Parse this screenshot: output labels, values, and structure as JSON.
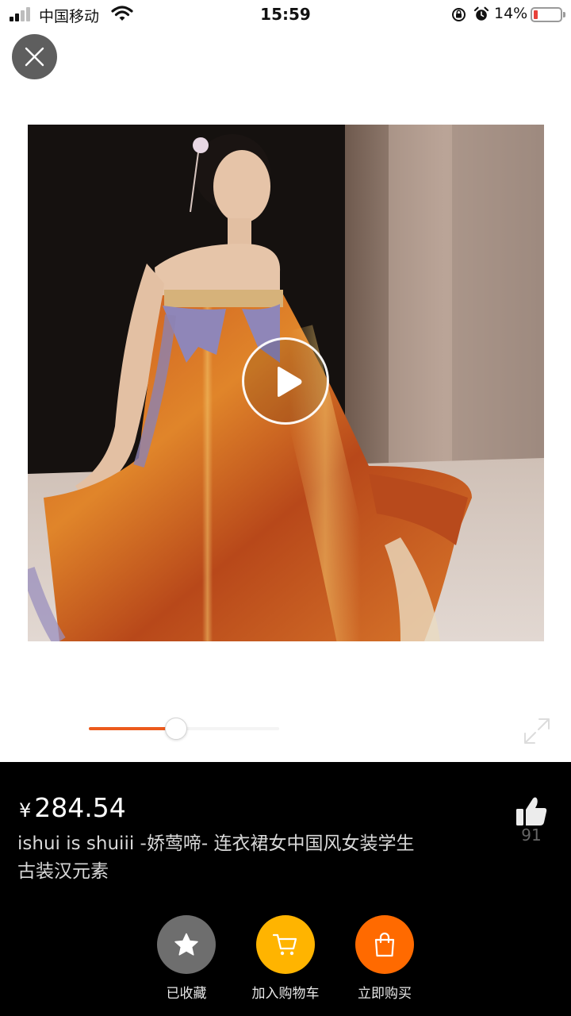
{
  "status_bar": {
    "carrier": "中国移动",
    "time": "15:59",
    "battery_percent": "14%",
    "battery_level": 0.14,
    "icons": [
      "signal-icon",
      "wifi-icon",
      "rotation-lock-icon",
      "alarm-icon",
      "battery-icon"
    ]
  },
  "header": {
    "close_icon": "close-icon"
  },
  "media": {
    "play_icon": "play-icon",
    "progress": 0.46,
    "fullscreen_icon": "expand-icon"
  },
  "product": {
    "currency": "¥",
    "price": "284.54",
    "title_line1": "ishui is shuiii -娇莺啼- 连衣裙女中国风女装学生",
    "title_line2": "古装汉元素",
    "like_count": "91"
  },
  "actions": {
    "favorite_label": "已收藏",
    "cart_label": "加入购物车",
    "buy_label": "立即购买"
  },
  "colors": {
    "accent_orange": "#ec5a1c",
    "favorite_bg": "#6e6e6e",
    "cart_bg": "#ffb400",
    "buy_bg": "#ff6a00",
    "panel_bg": "#000000"
  }
}
